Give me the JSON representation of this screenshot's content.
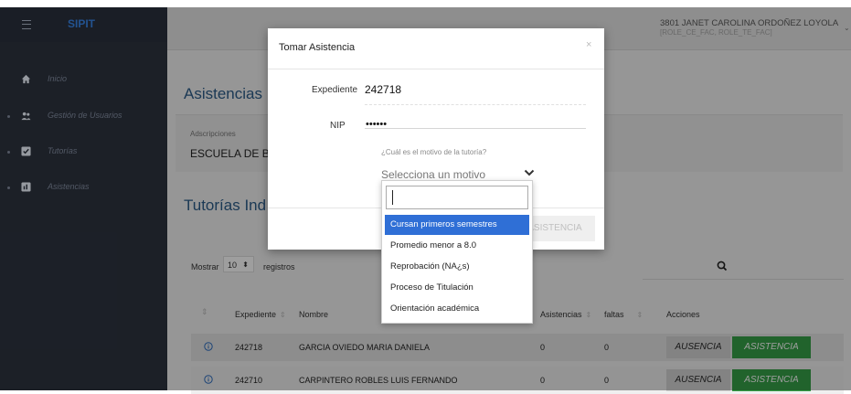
{
  "app": {
    "brand": "SIPIT"
  },
  "sidebar": {
    "items": [
      {
        "label": "Inicio",
        "icon": "home-icon"
      },
      {
        "label": "Gestión de Usuarios",
        "icon": "users-icon"
      },
      {
        "label": "Tutorías",
        "icon": "check-square-icon"
      },
      {
        "label": "Asistencias",
        "icon": "bar-chart-icon"
      }
    ]
  },
  "user": {
    "name": "3801 JANET CAROLINA ORDOÑEZ LOYOLA",
    "roles": "[ROLE_CE_FAC, ROLE_TE_FAC]"
  },
  "main": {
    "page_title": "Asistencias",
    "adscripciones_label": "Adscripciones",
    "adscripciones_value": "ESCUELA DE B",
    "section_title": "Tutorías Ind",
    "mostrar_label": "Mostrar",
    "length_value": "10",
    "registros_label": "registros",
    "table": {
      "headers": [
        "Expediente",
        "Nombre",
        "Asistencias",
        "faltas",
        "Acciones"
      ],
      "rows": [
        {
          "expediente": "242718",
          "nombre": "GARCIA OVIEDO MARIA DANIELA",
          "asistencias": "0",
          "faltas": "0"
        },
        {
          "expediente": "242710",
          "nombre": "CARPINTERO ROBLES LUIS FERNANDO",
          "asistencias": "0",
          "faltas": "0"
        }
      ],
      "btn_ausencia": "AUSENCIA",
      "btn_asistencia": "ASISTENCIA"
    }
  },
  "modal": {
    "title": "Tomar Asistencia",
    "close": "×",
    "expediente_label": "Expediente",
    "expediente_value": "242718",
    "nip_label": "NIP",
    "nip_value": "••••••",
    "motivo_label": "¿Cuál es el motivo de la tutoría?",
    "motivo_placeholder": "Selecciona un motivo",
    "asistencia_button": "ASISTENCIA"
  },
  "dropdown": {
    "options": [
      "Cursan primeros semestres",
      "Promedio menor a 8.0",
      "Reprobación (NA¿s)",
      "Proceso de Titulación",
      "Orientación académica"
    ],
    "active_index": 0
  },
  "colors": {
    "sidebar": "#262b35",
    "brand": "#2f6fc1",
    "title": "#2d5d8a",
    "success": "#36a047",
    "dropdown_active": "#2f6fd6"
  }
}
